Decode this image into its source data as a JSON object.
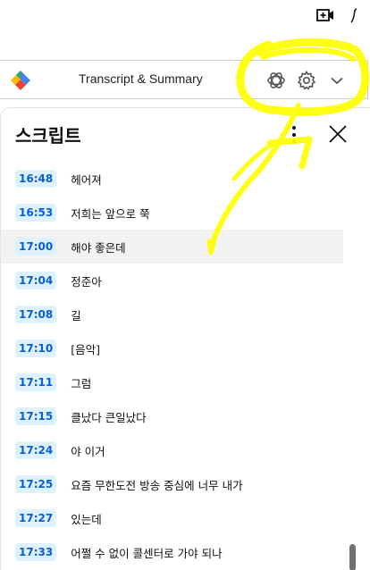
{
  "extension": {
    "title": "Transcript & Summary"
  },
  "panel": {
    "title": "스크립트"
  },
  "segments": [
    {
      "time": "16:48",
      "text": "헤어져"
    },
    {
      "time": "16:53",
      "text": "저희는 앞으로 쭉"
    },
    {
      "time": "17:00",
      "text": "해야 좋은데",
      "active": true
    },
    {
      "time": "17:04",
      "text": "정준아"
    },
    {
      "time": "17:08",
      "text": "길"
    },
    {
      "time": "17:10",
      "text": "[음악]"
    },
    {
      "time": "17:11",
      "text": "그럼"
    },
    {
      "time": "17:15",
      "text": "클났다 큰일났다"
    },
    {
      "time": "17:24",
      "text": "야 이거"
    },
    {
      "time": "17:25",
      "text": "요즘 무한도전 방송 중심에 너무 내가"
    },
    {
      "time": "17:27",
      "text": "있는데"
    },
    {
      "time": "17:33",
      "text": "어쩔 수 없이 콜센터로 가야 되나"
    }
  ],
  "colors": {
    "highlighter": "#ffff00",
    "timestamp_bg": "#def1ff",
    "timestamp_text": "#065fd4",
    "active_row": "#f2f2f2"
  },
  "icons": {
    "top": [
      "add-video-icon",
      "info-icon"
    ],
    "extension": [
      "openai-icon",
      "gear-icon",
      "chevron-down-icon"
    ],
    "panel": [
      "more-vert-icon",
      "close-icon"
    ]
  }
}
